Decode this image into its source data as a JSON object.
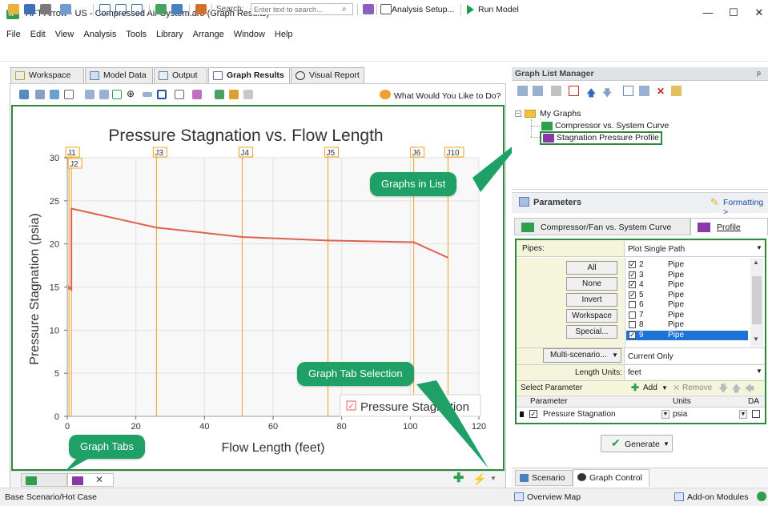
{
  "window": {
    "title": "AFT Arrow - US - Compressed Air System.aro (Graph Results)",
    "minimize": "—",
    "maximize": "☐",
    "close": "✕"
  },
  "menu": [
    "File",
    "Edit",
    "View",
    "Analysis",
    "Tools",
    "Library",
    "Arrange",
    "Window",
    "Help"
  ],
  "toolbar": {
    "search_label": "Search:",
    "search_placeholder": "Enter text to search...",
    "analysis_setup": "Analysis Setup...",
    "run_model": "Run Model"
  },
  "tabs": [
    {
      "label": "Workspace",
      "active": false
    },
    {
      "label": "Model Data",
      "active": false
    },
    {
      "label": "Output",
      "active": false
    },
    {
      "label": "Graph Results",
      "active": true
    },
    {
      "label": "Visual Report",
      "active": false
    }
  ],
  "graph_toolbar": {
    "help_link": "What Would You Like to Do?"
  },
  "chart_data": {
    "type": "line",
    "title": "Pressure Stagnation vs. Flow Length",
    "xlabel": "Flow Length (feet)",
    "ylabel": "Pressure Stagnation (psia)",
    "xlim": [
      0,
      120
    ],
    "ylim": [
      0,
      30
    ],
    "xticks": [
      0,
      20,
      40,
      60,
      80,
      100,
      120
    ],
    "yticks": [
      0,
      5,
      10,
      15,
      20,
      25,
      30
    ],
    "grid": true,
    "series": [
      {
        "name": "Pressure Stagnation",
        "color": "#e06050",
        "x": [
          0.5,
          0.5,
          1.2,
          1.2,
          26,
          51,
          76,
          101,
          111
        ],
        "y": [
          14.7,
          15.0,
          14.7,
          24.1,
          21.9,
          20.8,
          20.4,
          20.2,
          18.4
        ]
      }
    ],
    "junction_markers": [
      {
        "label": "J1",
        "x": 0.5
      },
      {
        "label": "J2",
        "x": 1.2
      },
      {
        "label": "J3",
        "x": 26
      },
      {
        "label": "J4",
        "x": 51
      },
      {
        "label": "J5",
        "x": 76
      },
      {
        "label": "J6",
        "x": 101
      },
      {
        "label": "J10",
        "x": 111
      }
    ],
    "legend_position": "bottom-right",
    "legend_label": "Pressure Stagnation"
  },
  "callouts": {
    "graphs_in_list": "Graphs in List",
    "graph_tab_selection": "Graph Tab Selection",
    "graph_tabs": "Graph Tabs"
  },
  "graph_list_manager": {
    "title": "Graph List Manager",
    "pin": "ᵽ",
    "root": "My Graphs",
    "items": [
      "Compressor vs. System Curve",
      "Stagnation Pressure Profile"
    ]
  },
  "parameters": {
    "title": "Parameters",
    "formatting": "Formatting >",
    "tab1": "Compressor/Fan vs. System Curve",
    "tab2": "Profile",
    "pipes_label": "Pipes:",
    "pipes_value": "Plot Single Path",
    "buttons": [
      "All",
      "None",
      "Invert",
      "Workspace",
      "Special..."
    ],
    "pipes": [
      {
        "num": "2",
        "type": "Pipe",
        "checked": true,
        "selected": false
      },
      {
        "num": "3",
        "type": "Pipe",
        "checked": true,
        "selected": false
      },
      {
        "num": "4",
        "type": "Pipe",
        "checked": true,
        "selected": false
      },
      {
        "num": "5",
        "type": "Pipe",
        "checked": true,
        "selected": false
      },
      {
        "num": "6",
        "type": "Pipe",
        "checked": false,
        "selected": false
      },
      {
        "num": "7",
        "type": "Pipe",
        "checked": false,
        "selected": false
      },
      {
        "num": "8",
        "type": "Pipe",
        "checked": false,
        "selected": false
      },
      {
        "num": "9",
        "type": "Pipe",
        "checked": true,
        "selected": true
      }
    ],
    "multi_scenario": "Multi-scenario...",
    "multi_value": "Current Only",
    "length_units_label": "Length Units:",
    "length_units_value": "feet",
    "select_parameter": "Select Parameter",
    "add": "Add",
    "remove": "Remove",
    "table_headers": {
      "param": "Parameter",
      "units": "Units",
      "da": "DA"
    },
    "table_row": {
      "param": "Pressure Stagnation",
      "units": "psia"
    },
    "generate": "Generate"
  },
  "right_bottom_tabs": [
    "Scenario",
    "Graph Control"
  ],
  "status": {
    "left": "Base Scenario/Hot Case",
    "overview_map": "Overview Map",
    "addon_modules": "Add-on Modules"
  },
  "colors": {
    "accent_green": "#2b8a3e",
    "callout_green": "#1ea067",
    "line_red": "#e06050",
    "junction_orange": "#f0a020",
    "select_blue": "#1e73d6"
  }
}
